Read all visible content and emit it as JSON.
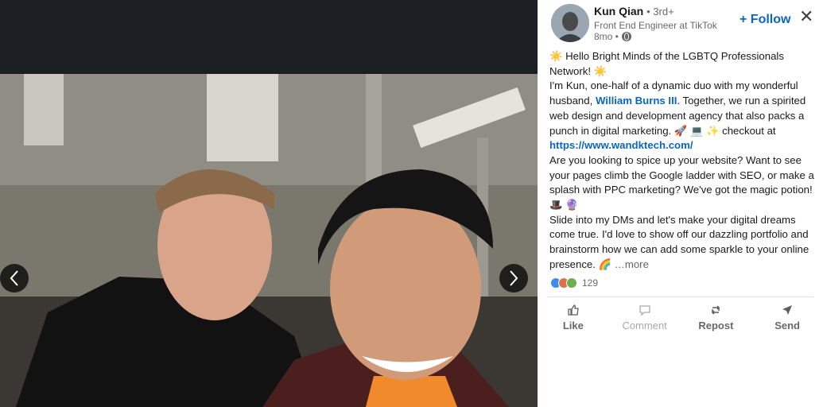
{
  "media": {
    "prev_icon": "chevron-left-icon",
    "next_icon": "chevron-right-icon"
  },
  "post": {
    "author_name": "Kun Qian",
    "degree": "• 3rd+",
    "headline": "Front End Engineer at TikTok",
    "time": "8mo •",
    "follow_label": "+ Follow",
    "close_icon": "✕",
    "body": {
      "line1": "☀️ Hello Bright Minds of the LGBTQ Professionals Network! ☀️",
      "line2_a": "I'm Kun, one-half of a dynamic duo with my wonderful husband, ",
      "mention": "William Burns III",
      "line2_b": ". Together, we run a spirited web design and development agency that also packs a punch in digital marketing. 🚀 💻 ✨ checkout at ",
      "url": "https://www.wandktech.com/",
      "line3": "Are you looking to spice up your website? Want to see your pages climb the Google ladder with SEO, or make a splash with PPC marketing? We've got the magic potion! 🎩 🔮",
      "line4": "Slide into my DMs and let's make your digital dreams come true. I'd love to show off our dazzling portfolio and brainstorm how we can add some sparkle to your online presence. 🌈 ",
      "more": "…more"
    },
    "reactions_count": "129",
    "actions": [
      {
        "label": "Like",
        "icon": "thumbs-up-icon"
      },
      {
        "label": "Comment",
        "icon": "comment-icon"
      },
      {
        "label": "Repost",
        "icon": "repost-icon"
      },
      {
        "label": "Send",
        "icon": "send-icon"
      }
    ]
  },
  "colors": {
    "accent": "#0a66c2",
    "media_bg": "#1b1f23"
  }
}
